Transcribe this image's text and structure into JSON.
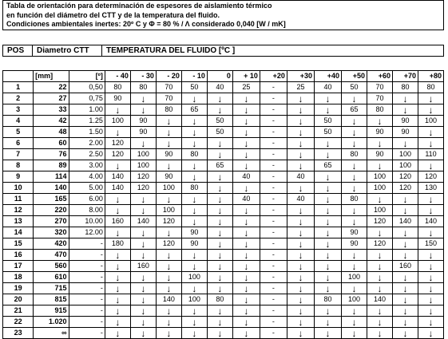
{
  "title": {
    "line1": "Tabla de orientación para determinación de espesores de aislamiento térmico",
    "line2": "en función del diámetro del CTT y de la temperatura del fluido.",
    "line3": "Condiciones ambientales inertes:     20º C   y    Φ = 80 %  /  Λ considerado 0,040 [W / mK]"
  },
  "header": {
    "pos": "POS",
    "diameter": "Diametro CTT",
    "temperature": "TEMPERATURA DEL FLUIDO [ºC ]"
  },
  "units": {
    "mm": "[mm]",
    "deg": "[º]"
  },
  "temperatures": [
    "- 40",
    "- 30",
    "- 20",
    "- 10",
    "0",
    "+ 10",
    "+20",
    "+30",
    "+40",
    "+50",
    "+60",
    "+70",
    "+80"
  ],
  "rows": [
    {
      "pos": "1",
      "dia": "22",
      "ang": "0,50",
      "vals": [
        "80",
        "80",
        "70",
        "50",
        "40",
        "25",
        "-",
        "25",
        "40",
        "50",
        "70",
        "80",
        "80"
      ]
    },
    {
      "pos": "2",
      "dia": "27",
      "ang": "0,75",
      "vals": [
        "90",
        "↓",
        "70",
        "↓",
        "↓",
        "↓",
        "-",
        "↓",
        "↓",
        "↓",
        "70",
        "↓",
        "↓"
      ]
    },
    {
      "pos": "3",
      "dia": "33",
      "ang": "1.00",
      "vals": [
        "↓",
        "↓",
        "80",
        "65",
        "↓",
        "↓",
        "-",
        "↓",
        "↓",
        "65",
        "80",
        "↓",
        "↓"
      ]
    },
    {
      "pos": "4",
      "dia": "42",
      "ang": "1.25",
      "vals": [
        "100",
        "90",
        "↓",
        "↓",
        "50",
        "↓",
        "-",
        "↓",
        "50",
        "↓",
        "↓",
        "90",
        "100"
      ]
    },
    {
      "pos": "5",
      "dia": "48",
      "ang": "1.50",
      "vals": [
        "↓",
        "90",
        "↓",
        "↓",
        "50",
        "↓",
        "-",
        "↓",
        "50",
        "↓",
        "90",
        "90",
        "↓"
      ]
    },
    {
      "pos": "6",
      "dia": "60",
      "ang": "2.00",
      "vals": [
        "120",
        "↓",
        "↓",
        "↓",
        "↓",
        "↓",
        "-",
        "↓",
        "↓",
        "↓",
        "↓",
        "↓",
        "↓"
      ]
    },
    {
      "pos": "7",
      "dia": "76",
      "ang": "2.50",
      "vals": [
        "120",
        "100",
        "90",
        "80",
        "↓",
        "↓",
        "-",
        "↓",
        "↓",
        "80",
        "90",
        "100",
        "110"
      ]
    },
    {
      "pos": "8",
      "dia": "89",
      "ang": "3.00",
      "vals": [
        "↓",
        "100",
        "↓",
        "↓",
        "65",
        "↓",
        "-",
        "↓",
        "65",
        "↓",
        "↓",
        "100",
        "↓"
      ]
    },
    {
      "pos": "9",
      "dia": "114",
      "ang": "4.00",
      "vals": [
        "140",
        "120",
        "90",
        "↓",
        "↓",
        "40",
        "-",
        "40",
        "↓",
        "↓",
        "100",
        "120",
        "120"
      ]
    },
    {
      "pos": "10",
      "dia": "140",
      "ang": "5.00",
      "vals": [
        "140",
        "120",
        "100",
        "80",
        "↓",
        "↓",
        "-",
        "↓",
        "↓",
        "↓",
        "100",
        "120",
        "130"
      ]
    },
    {
      "pos": "11",
      "dia": "165",
      "ang": "6.00",
      "vals": [
        "↓",
        "↓",
        "↓",
        "↓",
        "↓",
        "40",
        "-",
        "40",
        "↓",
        "80",
        "↓",
        "↓",
        "↓"
      ]
    },
    {
      "pos": "12",
      "dia": "220",
      "ang": "8.00",
      "vals": [
        "↓",
        "↓",
        "100",
        "↓",
        "↓",
        "↓",
        "-",
        "↓",
        "↓",
        "↓",
        "100",
        "↓",
        "↓"
      ]
    },
    {
      "pos": "13",
      "dia": "270",
      "ang": "10.00",
      "vals": [
        "160",
        "140",
        "120",
        "↓",
        "↓",
        "↓",
        "-",
        "↓",
        "↓",
        "↓",
        "120",
        "140",
        "140"
      ]
    },
    {
      "pos": "14",
      "dia": "320",
      "ang": "12.00",
      "vals": [
        "↓",
        "↓",
        "↓",
        "90",
        "↓",
        "↓",
        "-",
        "↓",
        "↓",
        "90",
        "↓",
        "↓",
        "↓"
      ]
    },
    {
      "pos": "15",
      "dia": "420",
      "ang": "-",
      "vals": [
        "180",
        "↓",
        "120",
        "90",
        "↓",
        "↓",
        "-",
        "↓",
        "↓",
        "90",
        "120",
        "↓",
        "150"
      ]
    },
    {
      "pos": "16",
      "dia": "470",
      "ang": "-",
      "vals": [
        "↓",
        "↓",
        "↓",
        "↓",
        "↓",
        "↓",
        "-",
        "↓",
        "↓",
        "↓",
        "↓",
        "↓",
        "↓"
      ]
    },
    {
      "pos": "17",
      "dia": "560",
      "ang": "-",
      "vals": [
        "↓",
        "160",
        "↓",
        "↓",
        "↓",
        "↓",
        "-",
        "↓",
        "↓",
        "↓",
        "↓",
        "160",
        "↓"
      ]
    },
    {
      "pos": "18",
      "dia": "610",
      "ang": "-",
      "vals": [
        "↓",
        "↓",
        "↓",
        "100",
        "↓",
        "↓",
        "-",
        "↓",
        "↓",
        "100",
        "↓",
        "↓",
        "↓"
      ]
    },
    {
      "pos": "19",
      "dia": "715",
      "ang": "-",
      "vals": [
        "↓",
        "↓",
        "↓",
        "↓",
        "↓",
        "↓",
        "-",
        "↓",
        "↓",
        "↓",
        "↓",
        "↓",
        "↓"
      ]
    },
    {
      "pos": "20",
      "dia": "815",
      "ang": "-",
      "vals": [
        "↓",
        "↓",
        "140",
        "100",
        "80",
        "↓",
        "-",
        "↓",
        "80",
        "100",
        "140",
        "↓",
        "↓"
      ]
    },
    {
      "pos": "21",
      "dia": "915",
      "ang": "-",
      "vals": [
        "↓",
        "↓",
        "↓",
        "↓",
        "↓",
        "↓",
        "-",
        "↓",
        "↓",
        "↓",
        "↓",
        "↓",
        "↓"
      ]
    },
    {
      "pos": "22",
      "dia": "1.020",
      "ang": "-",
      "vals": [
        "↓",
        "↓",
        "↓",
        "↓",
        "↓",
        "↓",
        "-",
        "↓",
        "↓",
        "↓",
        "↓",
        "↓",
        "↓"
      ]
    },
    {
      "pos": "23",
      "dia": "∞",
      "ang": "-",
      "vals": [
        "↓",
        "↓",
        "↓",
        "↓",
        "↓",
        "↓",
        "-",
        "↓",
        "↓",
        "↓",
        "↓",
        "↓",
        "↓"
      ]
    }
  ]
}
